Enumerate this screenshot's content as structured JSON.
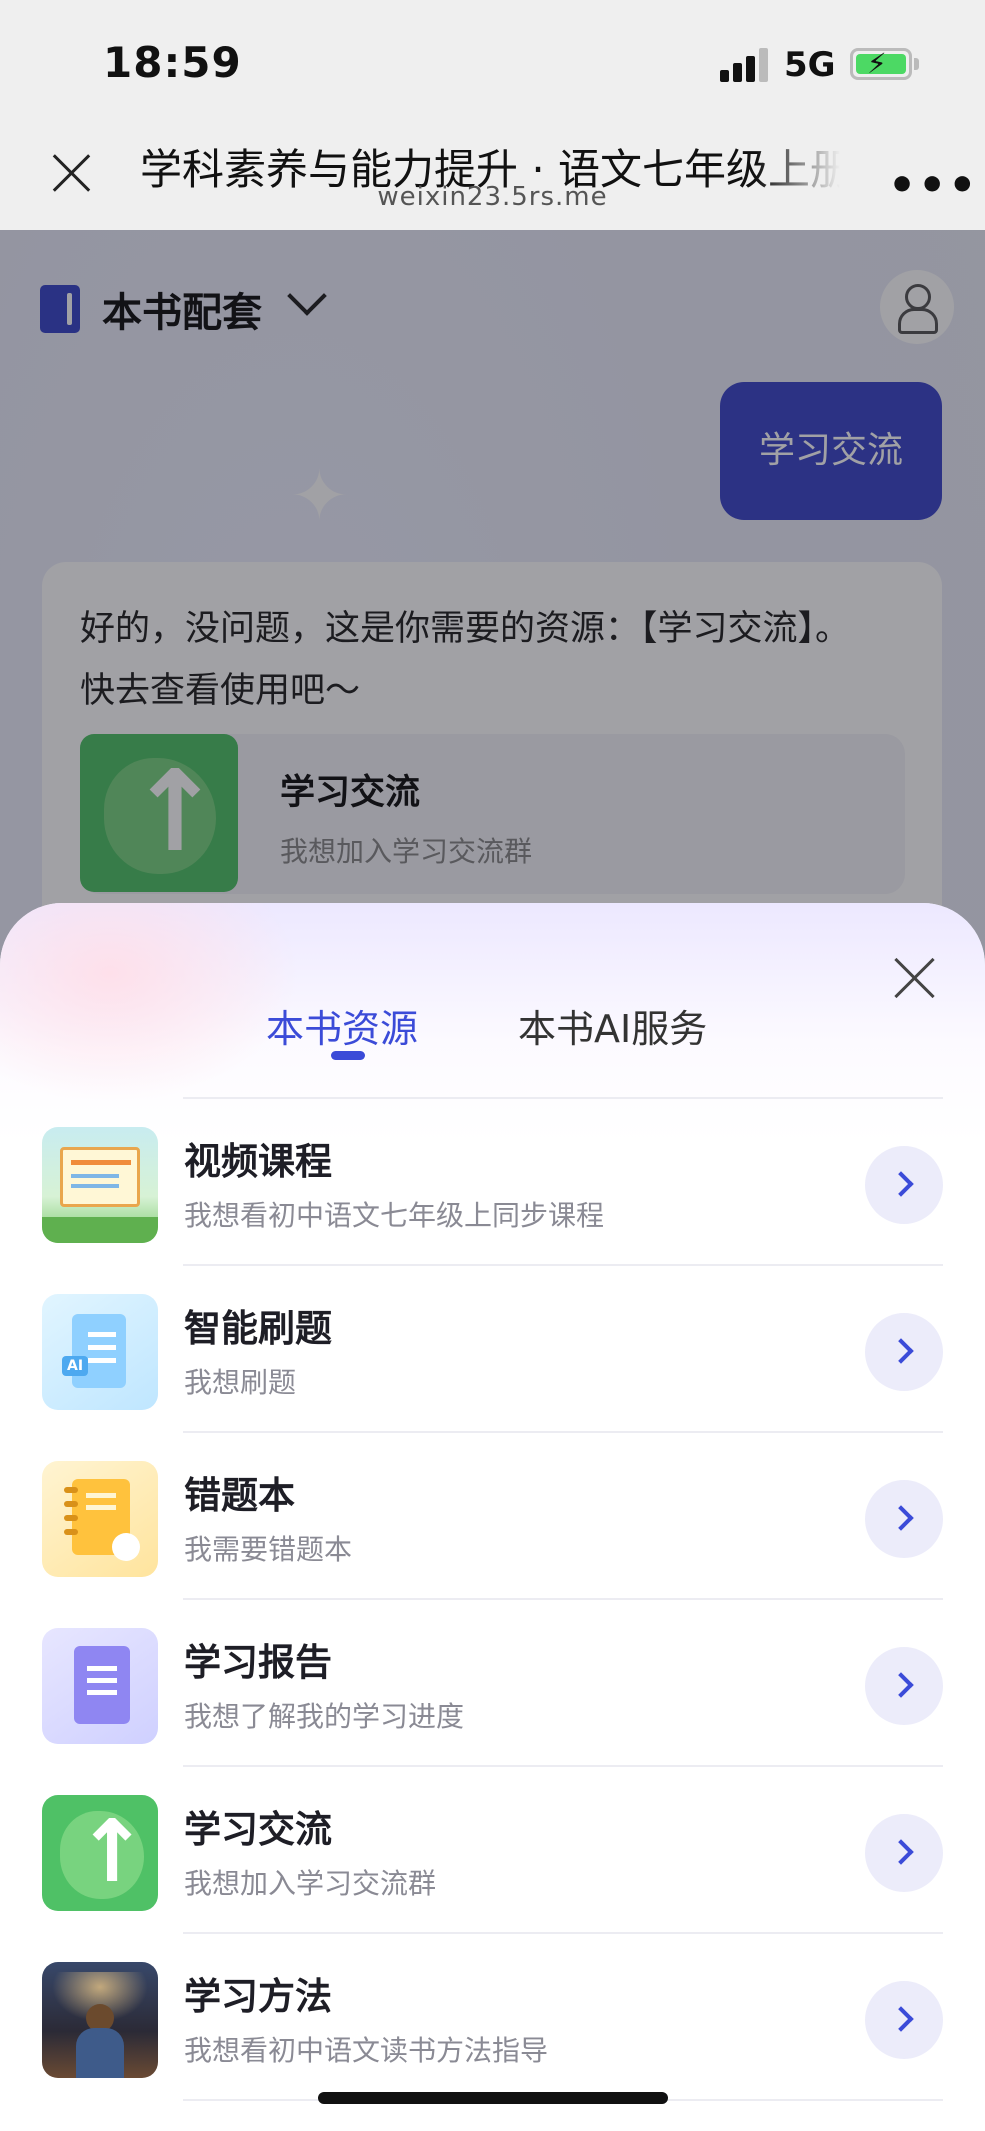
{
  "status_bar": {
    "time": "18:59",
    "network": "5G"
  },
  "nav": {
    "title": "学科素养与能力提升 · 语文七年级上册",
    "url": "weixin23.5rs.me",
    "more": "•••"
  },
  "page": {
    "header_label": "本书配套",
    "user_message": "学习交流",
    "bot_message": "好的，没问题，这是你需要的资源：【学习交流】。快去查看使用吧～",
    "bot_resource": {
      "title": "学习交流",
      "desc": "我想加入学习交流群"
    }
  },
  "sheet": {
    "tabs": [
      {
        "label": "本书资源",
        "active": true
      },
      {
        "label": "本书AI服务",
        "active": false
      }
    ],
    "items": [
      {
        "title": "视频课程",
        "desc": "我想看初中语文七年级上同步课程",
        "icon": "video-course-icon"
      },
      {
        "title": "智能刷题",
        "desc": "我想刷题",
        "icon": "smart-quiz-icon"
      },
      {
        "title": "错题本",
        "desc": "我需要错题本",
        "icon": "wrong-question-book-icon"
      },
      {
        "title": "学习报告",
        "desc": "我想了解我的学习进度",
        "icon": "study-report-icon"
      },
      {
        "title": "学习交流",
        "desc": "我想加入学习交流群",
        "icon": "study-exchange-icon"
      },
      {
        "title": "学习方法",
        "desc": "我想看初中语文读书方法指导",
        "icon": "study-method-icon"
      }
    ]
  },
  "colors": {
    "accent": "#3b4bd8",
    "user_bubble": "#3d47c9",
    "exchange_green": "#4fc166"
  }
}
